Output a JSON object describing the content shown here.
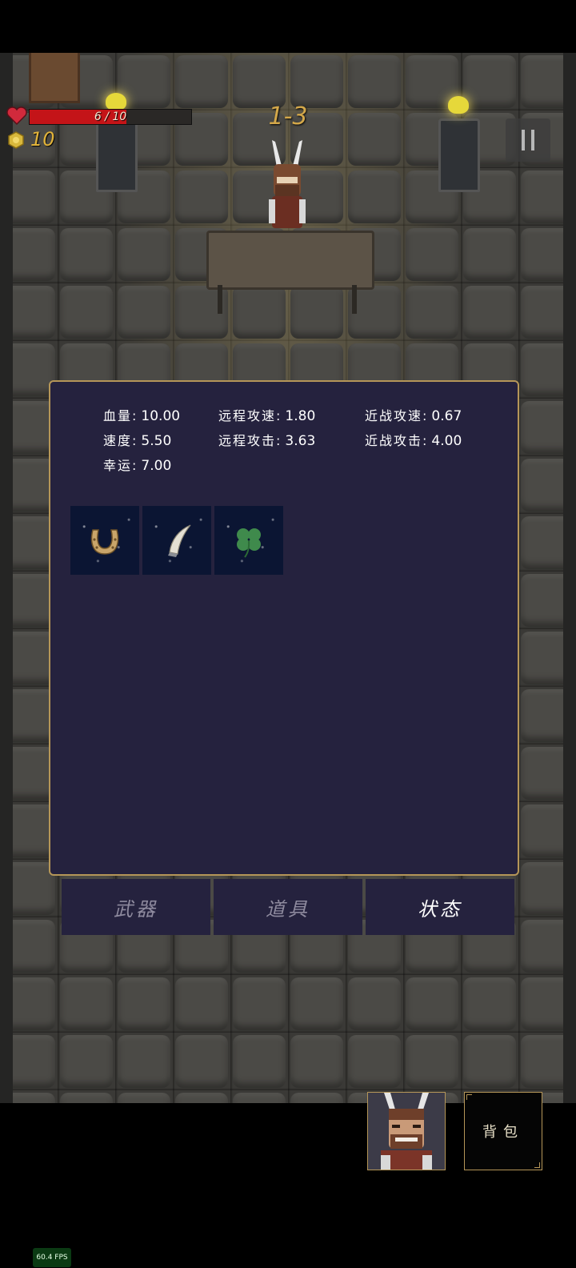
{
  "hud": {
    "hp_text": "6 / 10",
    "hp_fraction": 0.6,
    "gold": "10",
    "level": "1-3",
    "heart_icon": "heart-icon",
    "gold_icon": "gold-coin-icon",
    "pause_icon": "pause-icon"
  },
  "stats": {
    "hp": {
      "label": "血量:",
      "value": "10.00"
    },
    "ranged_speed": {
      "label": "远程攻速:",
      "value": "1.80"
    },
    "melee_speed": {
      "label": "近战攻速:",
      "value": "0.67"
    },
    "speed": {
      "label": "速度:",
      "value": "5.50"
    },
    "ranged_attack": {
      "label": "远程攻击:",
      "value": "3.63"
    },
    "melee_attack": {
      "label": "近战攻击:",
      "value": "4.00"
    },
    "luck": {
      "label": "幸运:",
      "value": "7.00"
    }
  },
  "items": [
    {
      "icon": "horseshoe-icon"
    },
    {
      "icon": "horn-icon"
    },
    {
      "icon": "four-leaf-clover-icon"
    }
  ],
  "tabs": [
    {
      "label": "武器",
      "active": false
    },
    {
      "label": "道具",
      "active": false
    },
    {
      "label": "状态",
      "active": true
    }
  ],
  "bottom": {
    "bag_label": "背包",
    "portrait_icon": "character-portrait-icon"
  },
  "fps": "60.4 FPS",
  "colors": {
    "panel_bg": "#25223e",
    "panel_border": "#b59658",
    "hp_fill": "#c41418",
    "gold": "#e1b33a"
  }
}
